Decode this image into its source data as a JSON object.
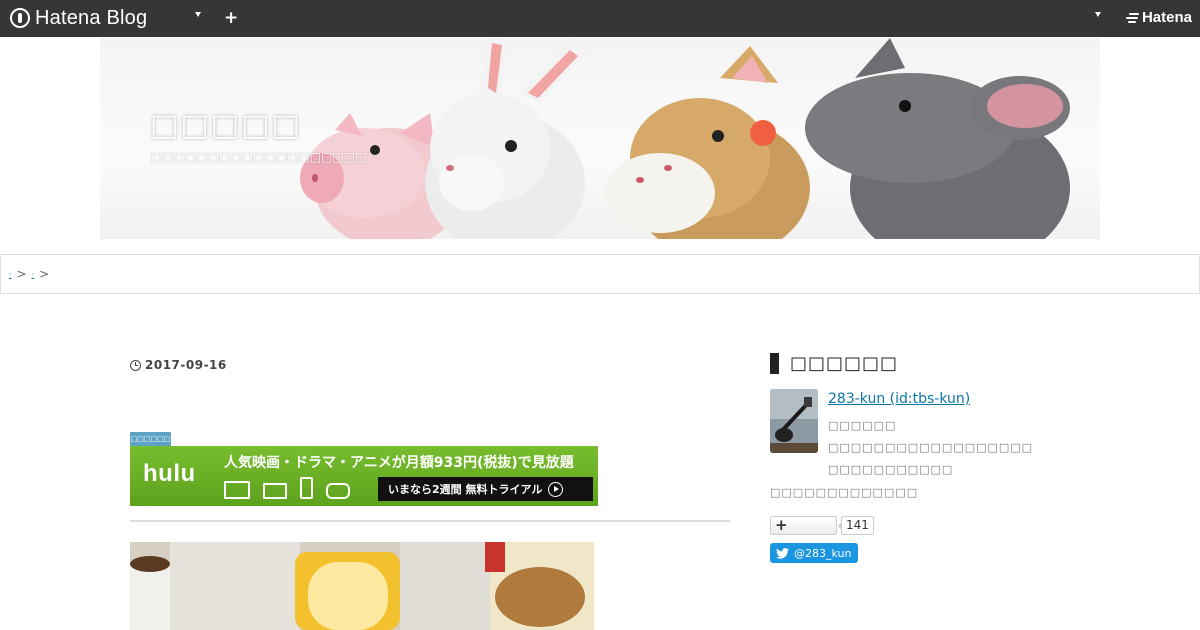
{
  "topbar": {
    "brand": "Hatena Blog",
    "add_label": "+",
    "hatena_label": "Hatena"
  },
  "header": {
    "blog_title": "□□□□□",
    "description": "□□□□□□□□□□□□□□□□□□□"
  },
  "breadcrumb": {
    "items": [
      "·",
      "·"
    ],
    "separator": ">"
  },
  "entry": {
    "date": "2017-09-16",
    "ad_label": "□□□□□□",
    "ad": {
      "logo": "hulu",
      "headline": "人気映画・ドラマ・アニメが月額933円(税抜)で見放題",
      "cta": "いまなら2週間 無料トライアル"
    }
  },
  "sidebar": {
    "title": "□□□□□□",
    "profile_name": "283-kun (id:tbs-kun)",
    "profile_lines": [
      "□□□□□□",
      "□□□□□□□□□□□□□□□□□□",
      "□□□□□□□□□□□"
    ],
    "profile_line4": "□□□□□□□□□□□□□",
    "subscribe_count": "141",
    "twitter_handle": "@283_kun"
  },
  "colors": {
    "topbar": "#363636",
    "link": "#0b75a8",
    "hulu_green": "#66ab22",
    "twitter_blue": "#1b95e0"
  }
}
